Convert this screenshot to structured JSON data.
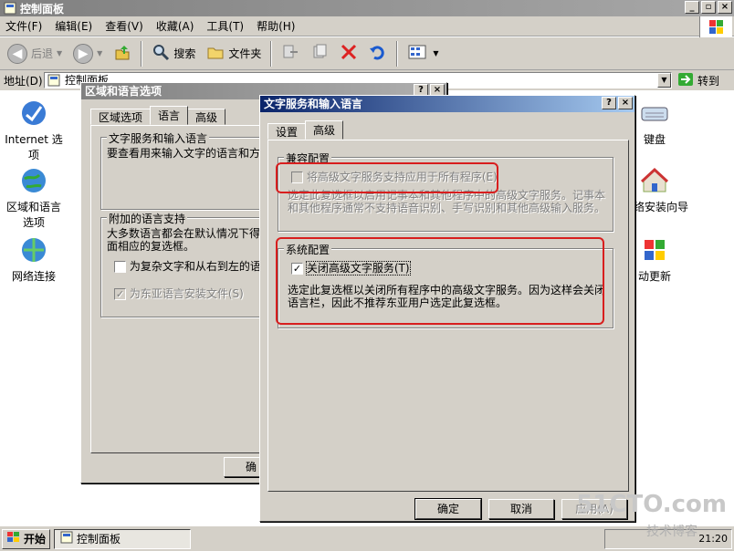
{
  "explorer": {
    "title": "控制面板",
    "menu": [
      "文件(F)",
      "编辑(E)",
      "查看(V)",
      "收藏(A)",
      "工具(T)",
      "帮助(H)"
    ],
    "toolbar": {
      "back": "后退",
      "search": "搜索",
      "folders": "文件夹"
    },
    "address_label": "地址(D)",
    "address_value": "控制面板",
    "go_label": "转到",
    "items": {
      "internet": "Internet 选项",
      "regional": "区域和语言选项",
      "network": "网络连接",
      "keyboard": "键盘",
      "wizard": "络安装向导",
      "update": "动更新"
    }
  },
  "regional_dialog": {
    "title": "区域和语言选项",
    "tabs": [
      "区域选项",
      "语言",
      "高级"
    ],
    "group1_legend": "文字服务和输入语言",
    "group1_text": "要查看用来输入文字的语言和方",
    "group2_legend": "附加的语言支持",
    "group2_text": "大多数语言都会在默认情况下得 下面相应的复选框。",
    "check1": "为复杂文字和从右到左的语",
    "check2": "为东亚语言安装文件(S)",
    "ok_fragment": "确"
  },
  "text_services_dialog": {
    "title": "文字服务和输入语言",
    "tabs": [
      "设置",
      "高级"
    ],
    "compat_legend": "兼容配置",
    "compat_check": "将高级文字服务支持应用于所有程序(E)",
    "compat_desc": "选定此复选框以启用记事本和其他程序中的高级文字服务。记事本和其他程序通常不支持语音识别、手写识别和其他高级输入服务。",
    "system_legend": "系统配置",
    "system_check": "关闭高级文字服务(T)",
    "system_desc": "选定此复选框以关闭所有程序中的高级文字服务。因为这样会关闭语言栏，因此不推荐东亚用户选定此复选框。",
    "ok": "确定",
    "cancel": "取消",
    "apply": "应用(A)"
  },
  "taskbar": {
    "start": "开始",
    "task": "控制面板",
    "time": "21:20"
  },
  "watermark": "51CTO.com",
  "watermark_sub": "技术博客"
}
